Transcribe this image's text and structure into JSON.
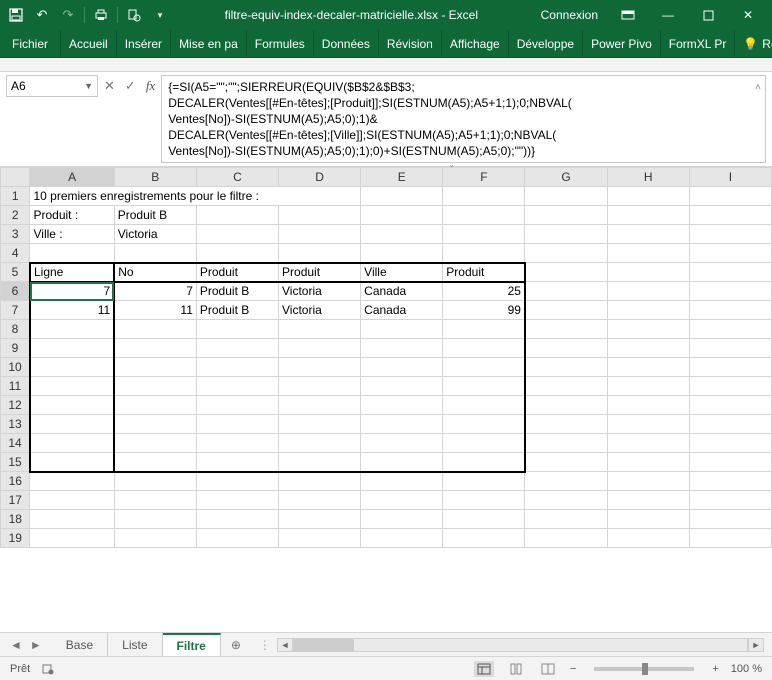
{
  "titlebar": {
    "filename": "filtre-equiv-index-decaler-matricielle.xlsx - Excel",
    "signin": "Connexion"
  },
  "ribbon": {
    "tabs": [
      "Fichier",
      "Accueil",
      "Insérer",
      "Mise en pa",
      "Formules",
      "Données",
      "Révision",
      "Affichage",
      "Développe",
      "Power Pivo",
      "FormXL Pr"
    ],
    "tell": "Recherch"
  },
  "namebox": "A6",
  "formula": [
    "{=SI(A5=\"\";\"\";SIERREUR(EQUIV($B$2&$B$3;",
    "DECALER(Ventes[[#En-têtes];[Produit]];SI(ESTNUM(A5);A5+1;1);0;NBVAL(",
    "Ventes[No])-SI(ESTNUM(A5);A5;0);1)&",
    "DECALER(Ventes[[#En-têtes];[Ville]];SI(ESTNUM(A5);A5+1;1);0;NBVAL(",
    "Ventes[No])-SI(ESTNUM(A5);A5;0);1);0)+SI(ESTNUM(A5);A5;0);\"\"))}"
  ],
  "columns": [
    "A",
    "B",
    "C",
    "D",
    "E",
    "F",
    "G",
    "H",
    "I"
  ],
  "rows": [
    "1",
    "2",
    "3",
    "4",
    "5",
    "6",
    "7",
    "8",
    "9",
    "10",
    "11",
    "12",
    "13",
    "14",
    "15",
    "16",
    "17",
    "18",
    "19"
  ],
  "cells": {
    "r1": {
      "A": "10 premiers enregistrements pour le filtre :"
    },
    "r2": {
      "A": "Produit :",
      "B": "Produit B"
    },
    "r3": {
      "A": "Ville :",
      "B": "Victoria"
    },
    "r5": {
      "A": "Ligne",
      "B": "No",
      "C": "Produit",
      "D": "Produit",
      "E": "Ville",
      "F": "Produit"
    },
    "r6": {
      "A": "7",
      "B": "7",
      "C": "Produit B",
      "D": "Victoria",
      "E": "Canada",
      "F": "25"
    },
    "r7": {
      "A": "11",
      "B": "11",
      "C": "Produit B",
      "D": "Victoria",
      "E": "Canada",
      "F": "99"
    }
  },
  "sheets": {
    "list": [
      "Base",
      "Liste",
      "Filtre"
    ],
    "active": "Filtre"
  },
  "status": {
    "ready": "Prêt",
    "zoom": "100 %"
  }
}
